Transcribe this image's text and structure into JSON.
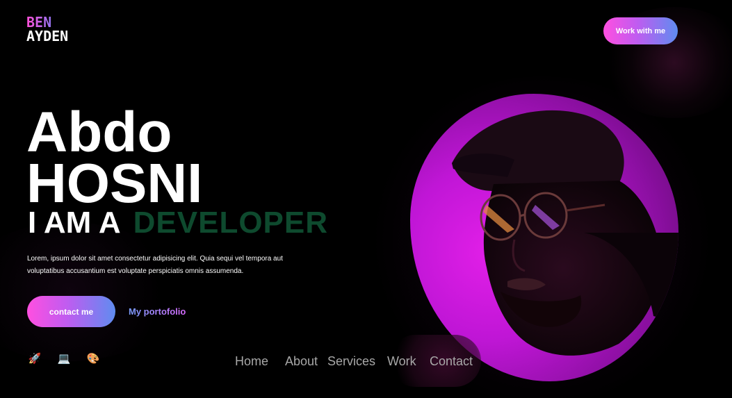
{
  "logo": {
    "line1": "BEN",
    "line2": "AYDEN"
  },
  "header": {
    "cta_label": "Work with me"
  },
  "hero": {
    "first_name": "Abdo",
    "last_name": "HOSNI",
    "role_prefix": "I AM A",
    "role_word": "DEVELOPER",
    "description": "Lorem, ipsum dolor sit amet consectetur adipisicing elit. Quia sequi vel tempora aut voluptatibus accusantium est voluptate perspiciatis omnis assumenda.",
    "contact_label": "contact me",
    "portfolio_label": "My portofolio"
  },
  "icons": [
    {
      "name": "rocket-icon",
      "glyph": "🚀"
    },
    {
      "name": "laptop-icon",
      "glyph": "💻"
    },
    {
      "name": "palette-icon",
      "glyph": "🎨"
    }
  ],
  "nav": {
    "items": [
      "Home",
      "About",
      "Services",
      "Work",
      "Contact"
    ]
  },
  "colors": {
    "accent_pink": "#ff4fe0",
    "accent_blue": "#5f8cf0",
    "role_green": "#0e4a2e",
    "portrait_magenta": "#d21ce0"
  }
}
